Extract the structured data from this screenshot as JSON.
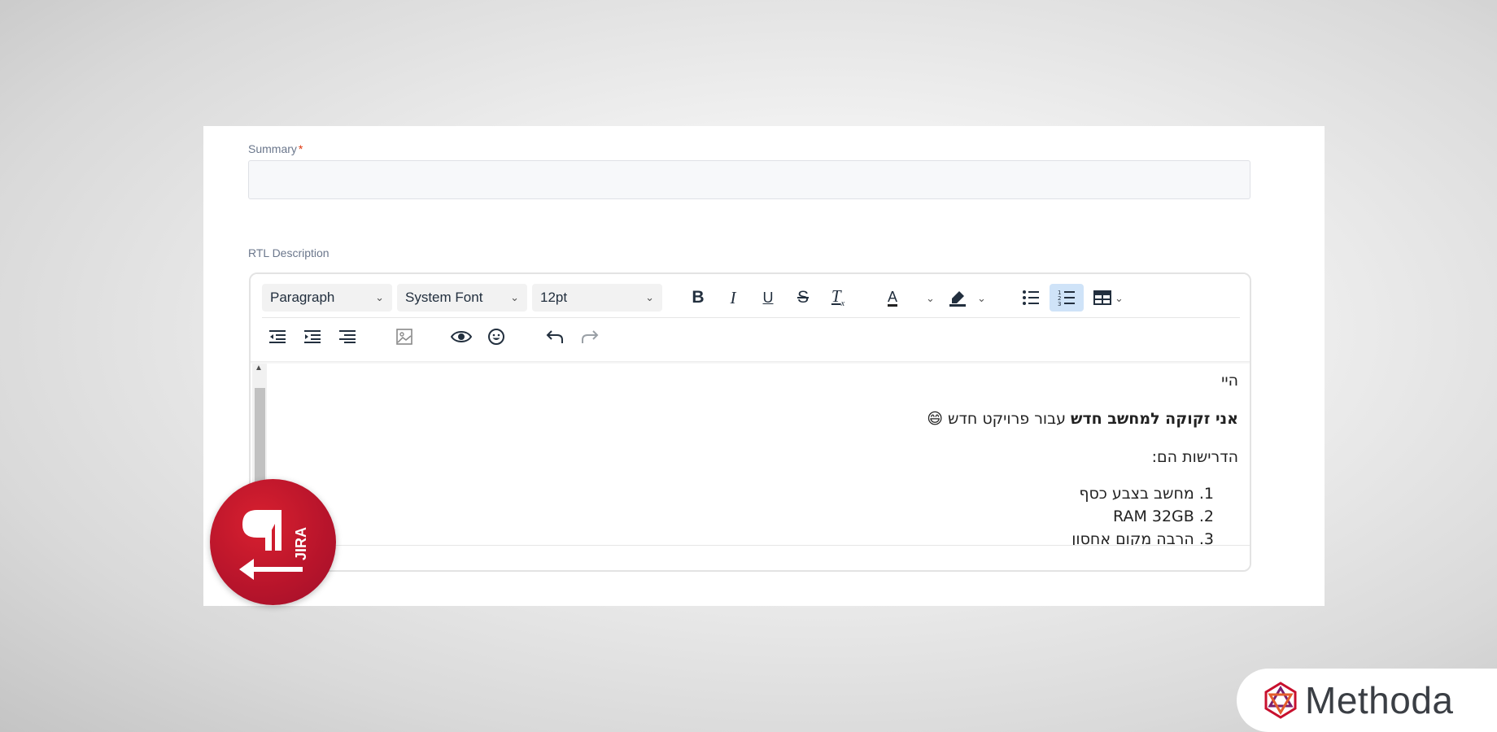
{
  "form": {
    "summary_label": "Summary",
    "required_mark": "*",
    "summary_value": "",
    "description_label": "RTL Description"
  },
  "toolbar": {
    "block_format": "Paragraph",
    "font_family": "System Font",
    "font_size": "12pt",
    "bold_icon": "bold-icon",
    "italic_icon": "italic-icon",
    "underline_icon": "underline-icon",
    "strikethrough_icon": "strikethrough-icon",
    "clear_format_icon": "clear-formatting-icon",
    "text_color_icon": "text-color-icon",
    "highlight_icon": "highlight-color-icon",
    "bullet_list_icon": "bullet-list-icon",
    "numbered_list_icon": "numbered-list-icon",
    "numbered_list_active": true,
    "table_icon": "table-icon",
    "outdent_icon": "outdent-icon",
    "indent_icon": "indent-icon",
    "align_right_icon": "align-right-icon",
    "image_icon": "image-icon",
    "preview_icon": "preview-eye-icon",
    "emoji_icon": "emoji-icon",
    "undo_icon": "undo-icon",
    "redo_icon": "redo-icon"
  },
  "content": {
    "greeting": "היי",
    "line2_bold": "אני זקוקה למחשב חדש",
    "line2_rest": " עבור פרויקט חדש ",
    "line2_emoji": "😄",
    "requirements_intro": "הדרישות הם:",
    "list_items": [
      "1. מחשב בצבע כסף",
      "2. RAM 32GB",
      "3. הרבה מקום אחסון"
    ]
  },
  "branding": {
    "app_logo_text": "JIRA",
    "vendor_name": "Methoda",
    "accent_color": "#c8102e"
  }
}
